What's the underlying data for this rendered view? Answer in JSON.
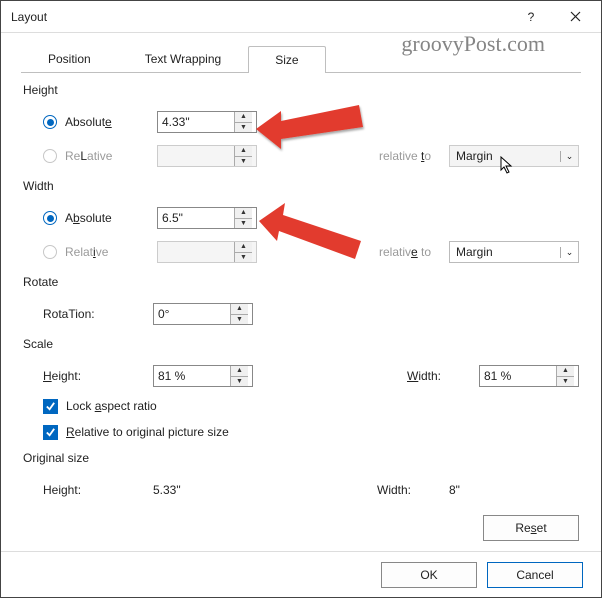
{
  "title": "Layout",
  "watermark": "groovyPost.com",
  "tabs": {
    "position": "Position",
    "textwrap": "Text Wrapping",
    "size": "Size"
  },
  "height": {
    "group": "Height",
    "absolute": "Absolute",
    "absolute_u": "e",
    "relative": "Relative",
    "relative_u": "L",
    "abs_val": "4.33\"",
    "rel_val": "",
    "relto": "relative to",
    "relto_u": "t",
    "relto_val": "Margin"
  },
  "width": {
    "group": "Width",
    "absolute": "Absolute",
    "absolute_u": "b",
    "relative": "Relative",
    "relative_u": "i",
    "abs_val": "6.5\"",
    "rel_val": "",
    "relto": "relative to",
    "relto_u": "e",
    "relto_val": "Margin"
  },
  "rotate": {
    "group": "Rotate",
    "label": "Rotation:",
    "label_u": "T",
    "value": "0°"
  },
  "scale": {
    "group": "Scale",
    "hlabel": "Height:",
    "hlabel_u": "H",
    "hval": "81 %",
    "wlabel": "Width:",
    "wlabel_u": "W",
    "wval": "81 %",
    "lock": "Lock aspect ratio",
    "lock_u": "a",
    "relorig": "Relative to original picture size",
    "relorig_u": "R"
  },
  "orig": {
    "group": "Original size",
    "hlabel": "Height:",
    "hval": "5.33\"",
    "wlabel": "Width:",
    "wval": "8\""
  },
  "reset": "Reset",
  "reset_u": "s",
  "ok": "OK",
  "cancel": "Cancel"
}
